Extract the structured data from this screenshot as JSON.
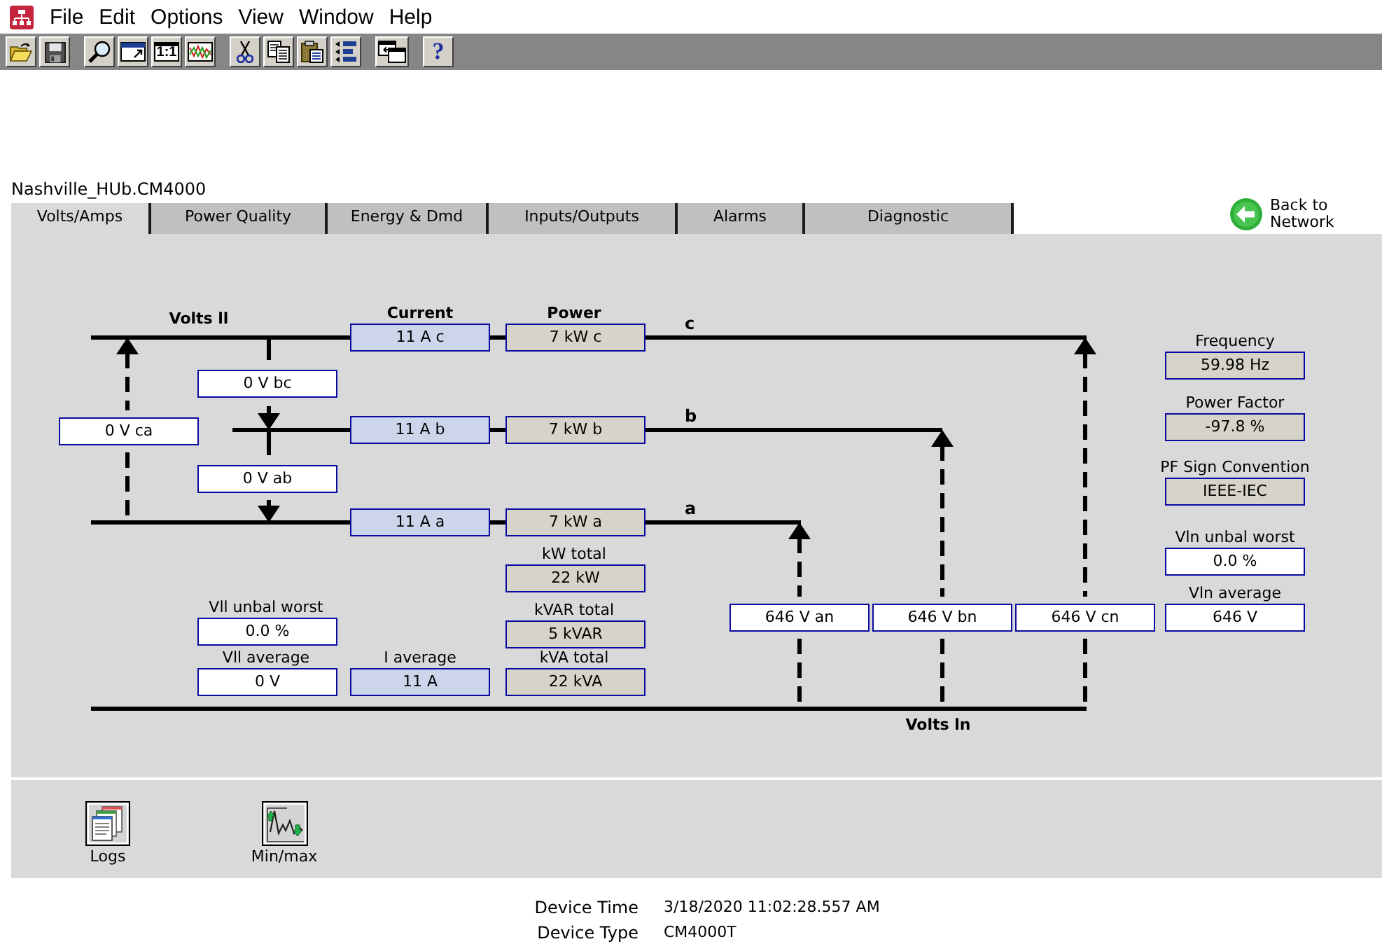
{
  "menu": [
    "File",
    "Edit",
    "Options",
    "View",
    "Window",
    "Help"
  ],
  "toolbar": [
    [
      {
        "kind": "open"
      },
      {
        "kind": "save"
      }
    ],
    [
      {
        "kind": "zoom"
      },
      {
        "kind": "fit"
      },
      {
        "kind": "actual",
        "label": "1:1"
      },
      {
        "kind": "trend"
      }
    ],
    [
      {
        "kind": "cut"
      },
      {
        "kind": "copy"
      },
      {
        "kind": "paste"
      },
      {
        "kind": "outline"
      }
    ],
    [
      {
        "kind": "window"
      }
    ],
    [
      {
        "kind": "help",
        "label": "?"
      }
    ]
  ],
  "device_name": "Nashville_HUb.CM4000",
  "tabs": [
    {
      "label": "Volts/Amps",
      "selected": true
    },
    {
      "label": "Power Quality",
      "selected": false
    },
    {
      "label": "Energy & Dmd",
      "selected": false
    },
    {
      "label": "Inputs/Outputs",
      "selected": false
    },
    {
      "label": "Alarms",
      "selected": false
    },
    {
      "label": "Diagnostic",
      "selected": false
    }
  ],
  "back_link": "Back to Network",
  "diagram": {
    "headings": {
      "volts_ll": "Volts ll",
      "current": "Current",
      "power": "Power",
      "volts_ln": "Volts ln"
    },
    "phases": [
      {
        "name": "c",
        "current": "11 A c",
        "power": "7 kW c"
      },
      {
        "name": "b",
        "current": "11 A b",
        "power": "7 kW b"
      },
      {
        "name": "a",
        "current": "11 A a",
        "power": "7 kW a"
      }
    ],
    "line_voltages": [
      "0 V bc",
      "0 V ca",
      "0 V ab"
    ],
    "totals": [
      {
        "caption": "kW total",
        "value": "22 kW"
      },
      {
        "caption": "kVAR total",
        "value": "5 kVAR"
      },
      {
        "caption": "kVA total",
        "value": "22 kVA"
      }
    ],
    "vll_unbal_worst": {
      "caption": "Vll unbal worst",
      "value": "0.0 %"
    },
    "vll_average": {
      "caption": "Vll average",
      "value": "0 V"
    },
    "i_average": {
      "caption": "I average",
      "value": "11 A"
    },
    "phase_voltages": [
      "646 V an",
      "646 V bn",
      "646 V cn"
    ]
  },
  "readings": [
    {
      "caption": "Frequency",
      "value": "59.98 Hz",
      "kind": "system"
    },
    {
      "caption": "Power Factor",
      "value": "-97.8 %",
      "kind": "system"
    },
    {
      "caption": "PF Sign Convention",
      "value": "IEEE-IEC",
      "kind": "system"
    },
    {
      "caption": "Vln unbal worst",
      "value": "0.0 %",
      "kind": "voltage"
    },
    {
      "caption": "Vln average",
      "value": "646 V",
      "kind": "voltage"
    }
  ],
  "shortcuts": [
    {
      "label": "Logs",
      "kind": "logs"
    },
    {
      "label": "Min/max",
      "kind": "minmax"
    }
  ],
  "device_info": [
    {
      "label": "Device Time",
      "value": "3/18/2020 11:02:28.557 AM"
    },
    {
      "label": "Device Type",
      "value": "CM4000T"
    }
  ]
}
